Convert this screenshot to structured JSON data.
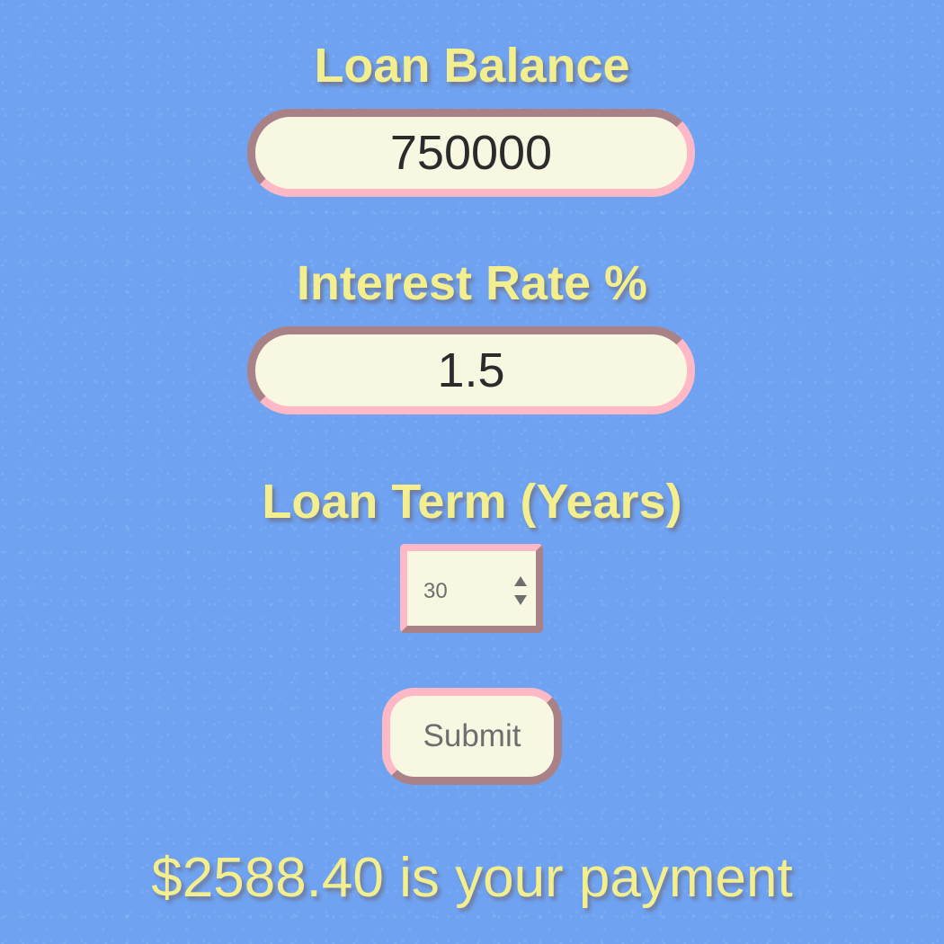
{
  "loan_balance": {
    "label": "Loan Balance",
    "value": "750000"
  },
  "interest_rate": {
    "label": "Interest Rate %",
    "value": "1.5"
  },
  "loan_term": {
    "label": "Loan Term (Years)",
    "selected": "30",
    "icon": "select-arrows-icon"
  },
  "submit": {
    "label": "Submit"
  },
  "result": {
    "text": "$2588.40 is your payment"
  },
  "colors": {
    "background": "#6fa3f2",
    "label_text": "#f3ee8e",
    "field_fill": "#f7f7e2",
    "border_pink": "#ffb8c6",
    "border_mauve": "#a88287"
  }
}
